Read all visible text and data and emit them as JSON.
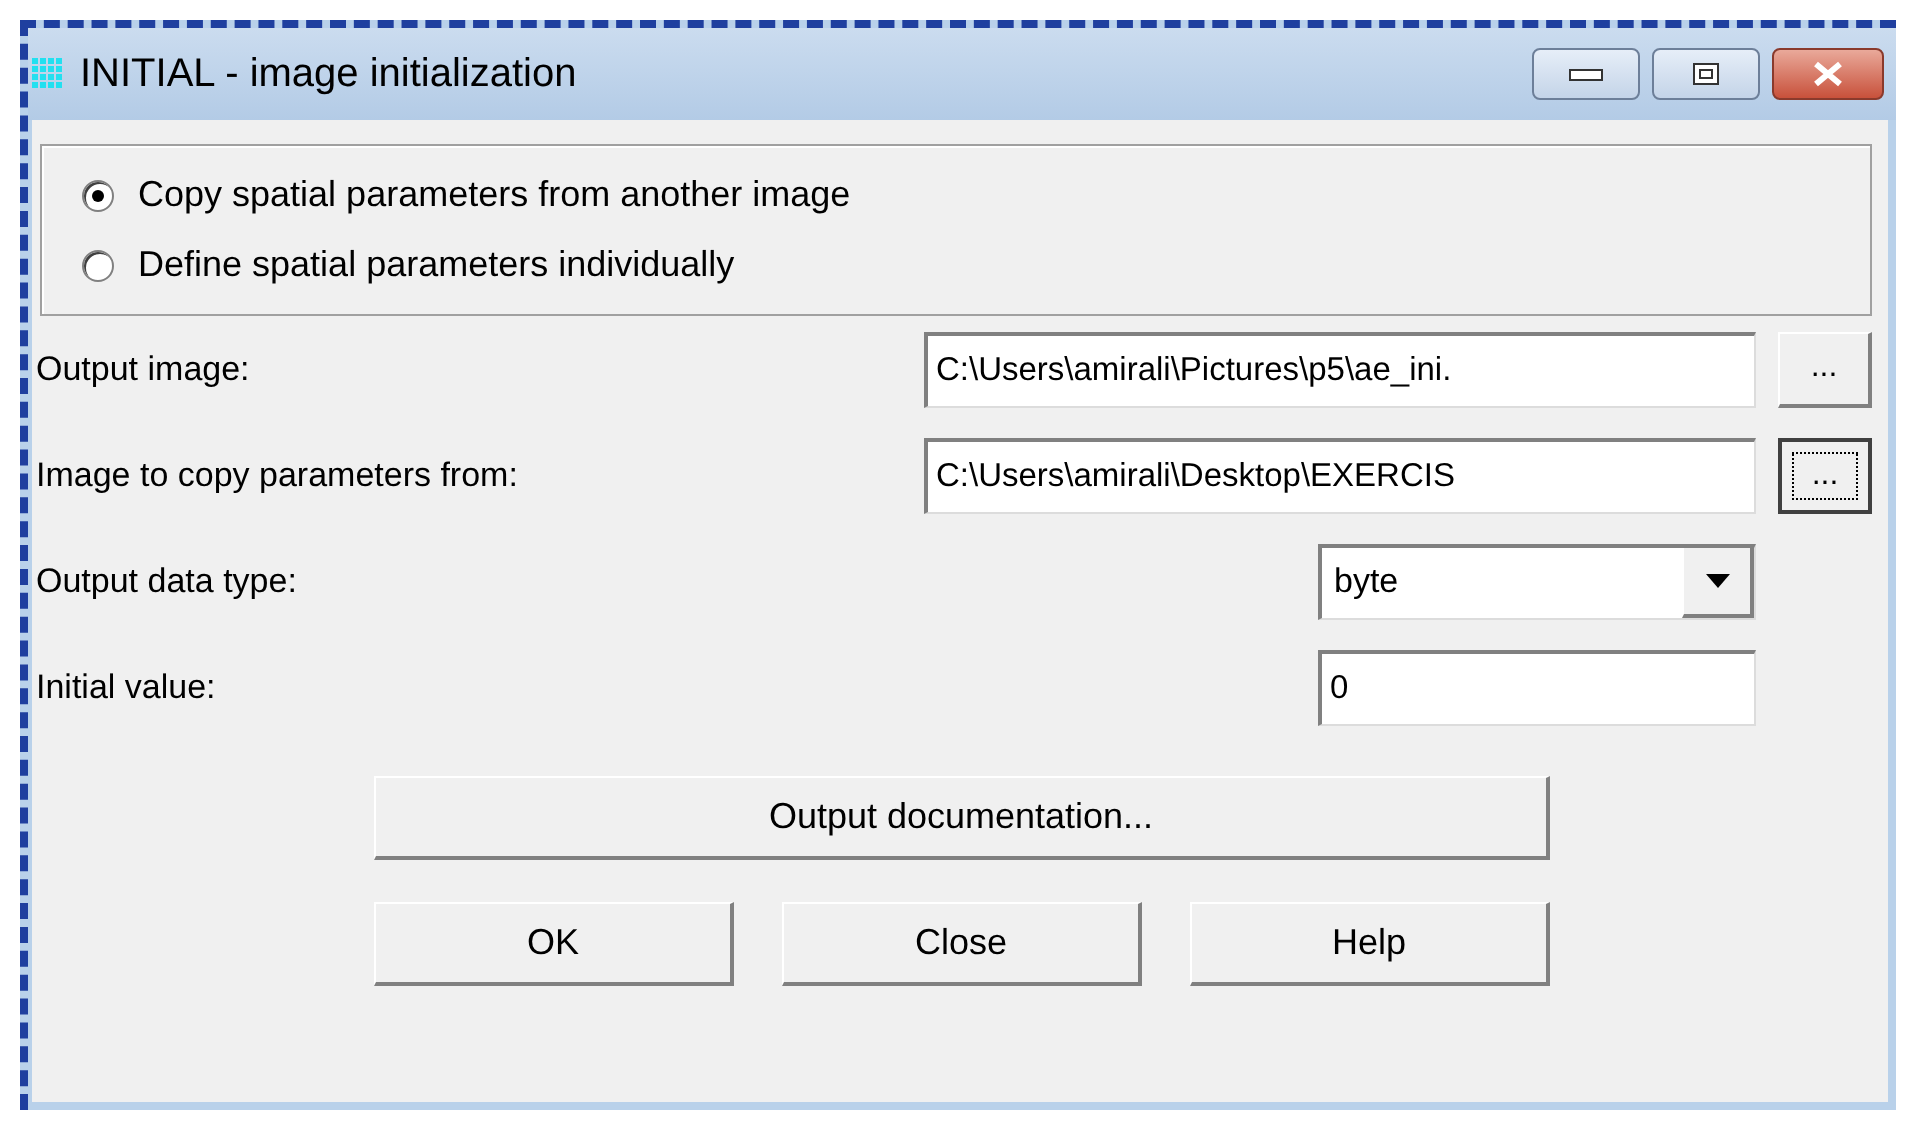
{
  "window": {
    "title": "INITIAL - image initialization"
  },
  "radio_options": [
    {
      "label": "Copy spatial parameters from another image",
      "selected": true
    },
    {
      "label": "Define spatial parameters individually",
      "selected": false
    }
  ],
  "file_fields": [
    {
      "label": "Output image:",
      "value": "C:\\Users\\amirali\\Pictures\\p5\\ae_ini.",
      "browse": "...",
      "focused": false
    },
    {
      "label": "Image to copy parameters from:",
      "value": "C:\\Users\\amirali\\Desktop\\EXERCIS",
      "browse": "...",
      "focused": true
    }
  ],
  "data_type": {
    "label": "Output data type:",
    "value": "byte"
  },
  "initial_value": {
    "label": "Initial value:",
    "value": "0"
  },
  "documentation_button": "Output documentation...",
  "buttons": [
    "OK",
    "Close",
    "Help"
  ]
}
